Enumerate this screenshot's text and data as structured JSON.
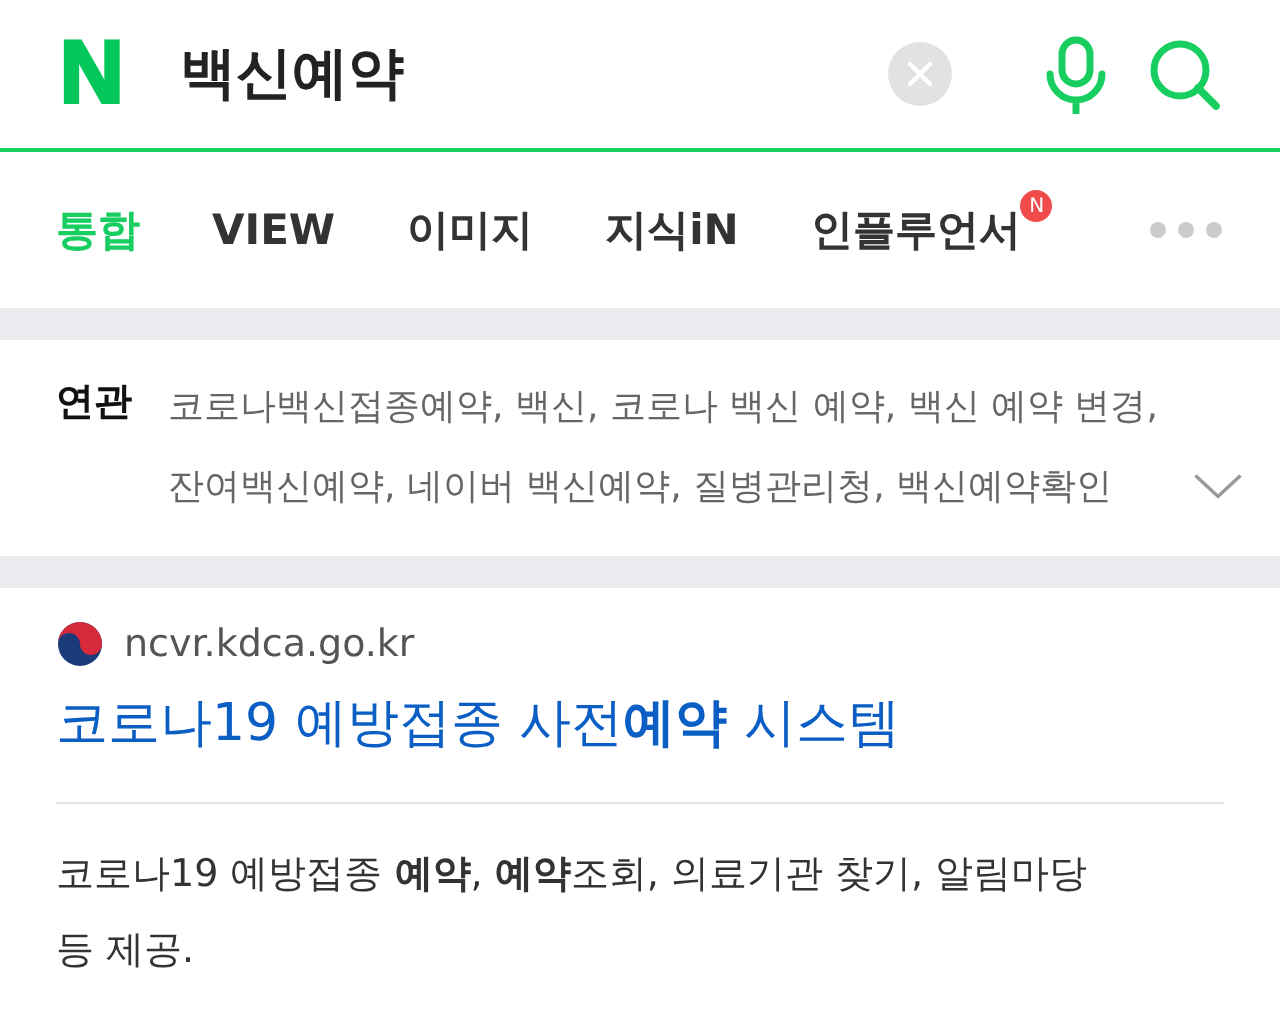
{
  "header": {
    "logo": "N",
    "query": "백신예약"
  },
  "tabs": [
    {
      "label": "통합",
      "selected": true
    },
    {
      "label": "VIEW",
      "selected": false
    },
    {
      "label": "이미지",
      "selected": false
    },
    {
      "label": "지식iN",
      "selected": false
    },
    {
      "label": "인플루언서",
      "selected": false,
      "badge": "N"
    }
  ],
  "related": {
    "label": "연관",
    "text": "코로나백신접종예약, 백신, 코로나 백신 예약, 백신 예약 변경, 잔여백신예약, 네이버 백신예약, 질병관리청, 백신예약확인"
  },
  "result": {
    "url": "ncvr.kdca.go.kr",
    "title": "코로나19 예방접종 사전**예약** 시스템",
    "description": "코로나19 예방접종 **예약**, **예약**조회, 의료기관 찾기, 알림마당 등 제공."
  }
}
